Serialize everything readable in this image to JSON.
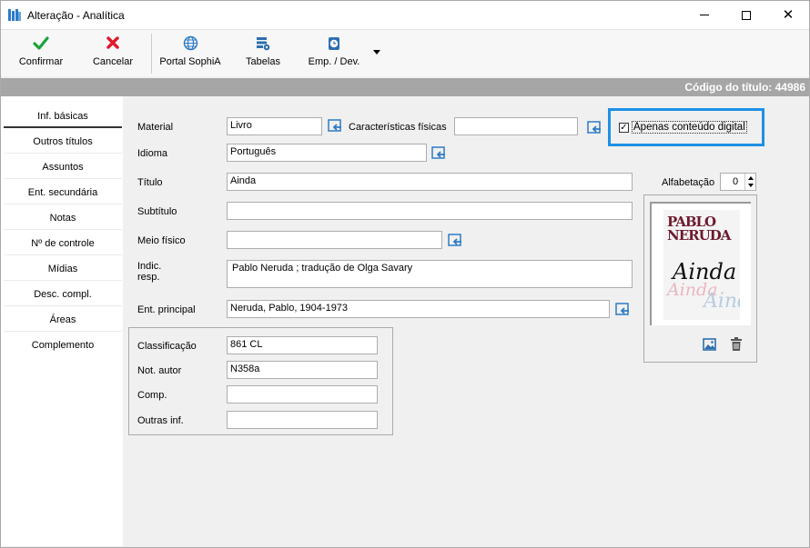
{
  "window": {
    "title": "Alteração - Analítica"
  },
  "toolbar": {
    "confirm_label": "Confirmar",
    "cancel_label": "Cancelar",
    "portal_label": "Portal SophiA",
    "tables_label": "Tabelas",
    "loan_label": "Emp. / Dev."
  },
  "header": {
    "code_text": "Código do título: 44986"
  },
  "sidebar": {
    "items": [
      {
        "label": "Inf. básicas"
      },
      {
        "label": "Outros títulos"
      },
      {
        "label": "Assuntos"
      },
      {
        "label": "Ent. secundária"
      },
      {
        "label": "Notas"
      },
      {
        "label": "Nº de controle"
      },
      {
        "label": "Mídias"
      },
      {
        "label": "Desc. compl."
      },
      {
        "label": "Áreas"
      },
      {
        "label": "Complemento"
      }
    ]
  },
  "form": {
    "material_label": "Material",
    "material_value": "Livro",
    "physical_label": "Características físicas",
    "physical_value": "",
    "digital_only_label": "Apenas conteúdo digital",
    "digital_only_checked": true,
    "language_label": "Idioma",
    "language_value": "Português",
    "title_label": "Título",
    "title_value": "Ainda",
    "subtitle_label": "Subtítulo",
    "subtitle_value": "",
    "medium_label": "Meio físico",
    "medium_value": "",
    "resp_label_1": "Indic.",
    "resp_label_2": "resp.",
    "resp_value": "Pablo Neruda ; tradução de Olga Savary",
    "main_entry_label": "Ent. principal",
    "main_entry_value": "Neruda, Pablo, 1904-1973",
    "alphabet_label": "Alfabetação",
    "alphabet_value": "0"
  },
  "classification": {
    "class_label": "Classificação",
    "class_value": "861 CL",
    "author_label": "Not. autor",
    "author_value": "N358a",
    "comp_label": "Comp.",
    "comp_value": "",
    "other_label": "Outras inf.",
    "other_value": ""
  },
  "cover": {
    "author_line1": "PABLO",
    "author_line2": "NERUDA",
    "title_text": "Ainda",
    "title_echo_1": "Ainda",
    "title_echo_2": "Ainda"
  },
  "colors": {
    "highlight_border": "#1e90e6",
    "header_band": "#a6a6a6",
    "confirm_green": "#1aa33b",
    "cancel_red": "#e0182d",
    "link_blue": "#2d7bc6"
  }
}
